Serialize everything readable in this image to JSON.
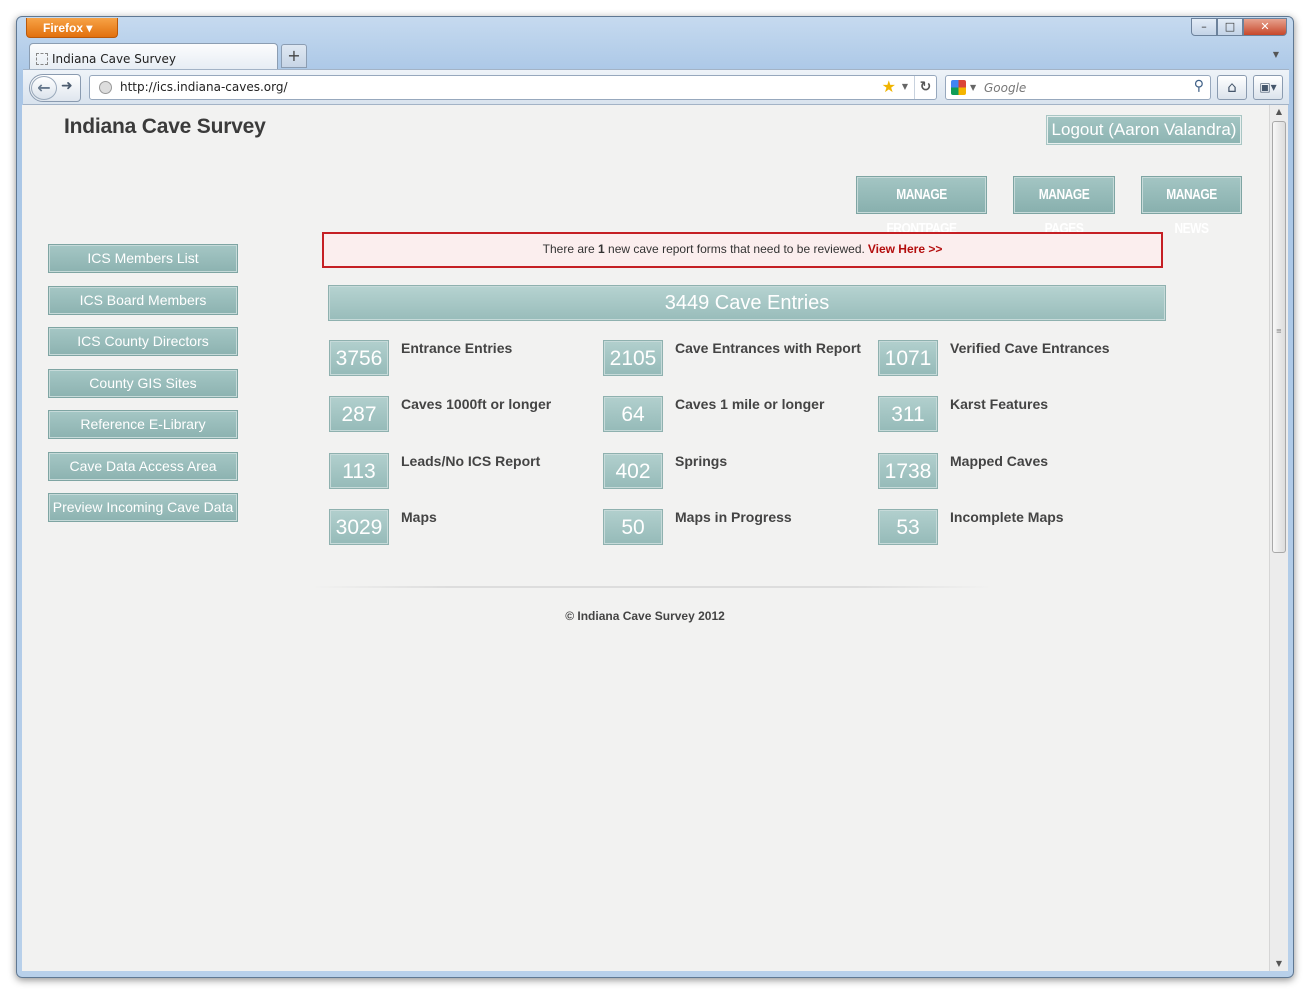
{
  "browser": {
    "app_button": "Firefox",
    "window_controls": {
      "minimize": "–",
      "maximize": "□",
      "close": "✕"
    },
    "tab_title": "Indiana Cave Survey",
    "new_tab": "+",
    "url": "http://ics.indiana-caves.org/",
    "search_placeholder": "Google"
  },
  "site": {
    "title": "Indiana Cave Survey",
    "logout_label": "Logout (Aaron Valandra)"
  },
  "admin_nav": [
    {
      "label": "MANAGE FRONTPAGE"
    },
    {
      "label": "MANAGE PAGES"
    },
    {
      "label": "MANAGE NEWS"
    }
  ],
  "sidebar": {
    "items": [
      {
        "label": "ICS Members List"
      },
      {
        "label": "ICS Board Members"
      },
      {
        "label": "ICS County Directors"
      },
      {
        "label": "County GIS Sites"
      },
      {
        "label": "Reference E-Library"
      },
      {
        "label": "Cave Data Access Area"
      },
      {
        "label": "Preview Incoming Cave Data"
      }
    ]
  },
  "alert": {
    "prefix": "There are ",
    "count": "1",
    "suffix": " new cave report forms that need to be reviewed.",
    "link": "View Here >>"
  },
  "summary": {
    "title": "3449 Cave Entries"
  },
  "stats": [
    {
      "value": "3756",
      "label": "Entrance Entries"
    },
    {
      "value": "2105",
      "label": "Cave Entrances with Report"
    },
    {
      "value": "1071",
      "label": "Verified Cave Entrances"
    },
    {
      "value": "287",
      "label": "Caves 1000ft or longer"
    },
    {
      "value": "64",
      "label": "Caves 1 mile or longer"
    },
    {
      "value": "311",
      "label": "Karst Features"
    },
    {
      "value": "113",
      "label": "Leads/No ICS Report"
    },
    {
      "value": "402",
      "label": "Springs"
    },
    {
      "value": "1738",
      "label": "Mapped Caves"
    },
    {
      "value": "3029",
      "label": "Maps"
    },
    {
      "value": "50",
      "label": "Maps in Progress"
    },
    {
      "value": "53",
      "label": "Incomplete Maps"
    }
  ],
  "footer": {
    "copyright": "© Indiana Cave Survey 2012"
  },
  "colors": {
    "button_teal": "#98bcba",
    "alert_border": "#c51f24",
    "alert_link": "#b30d0d",
    "page_bg": "#f2f2f1"
  }
}
